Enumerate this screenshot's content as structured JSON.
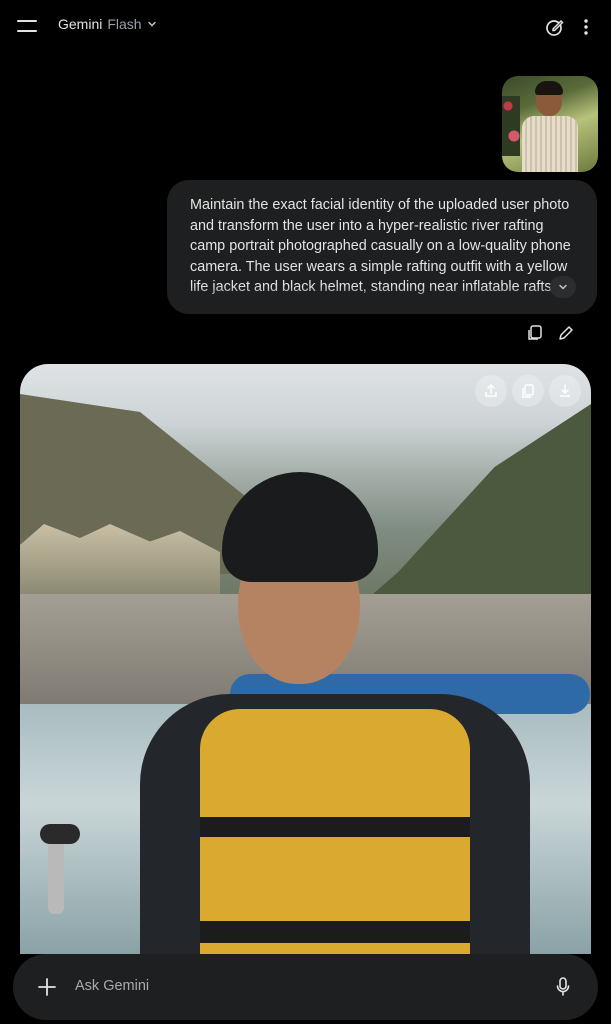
{
  "header": {
    "app_name": "Gemini",
    "model_name": "Flash",
    "menu_icon": "hamburger-menu-icon",
    "dropdown_icon": "chevron-down-icon",
    "new_chat_icon": "new-chat-pencil-icon",
    "more_icon": "more-vertical-icon"
  },
  "user_message": {
    "image_desc": "uploaded-user-photo",
    "prompt_text": "Maintain the exact facial identity of the uploaded user photo and transform the user into a hyper-realistic river rafting camp portrait photographed casually on a low-quality phone camera. The user wears a simple rafting outfit with a yellow life jacket and black helmet, standing near inflatable rafts",
    "expand_icon": "chevron-down-icon",
    "actions": [
      "copy-icon",
      "edit-icon"
    ]
  },
  "response": {
    "image_actions": [
      "share-icon",
      "copy-icon",
      "download-icon"
    ]
  },
  "composer": {
    "placeholder": "Ask Gemini",
    "plus_icon": "plus-icon",
    "mic_icon": "mic-icon"
  },
  "colors": {
    "background": "#000000",
    "surface": "#1e1f20",
    "text": "#e3e3e3",
    "muted": "#9aa0a6"
  }
}
